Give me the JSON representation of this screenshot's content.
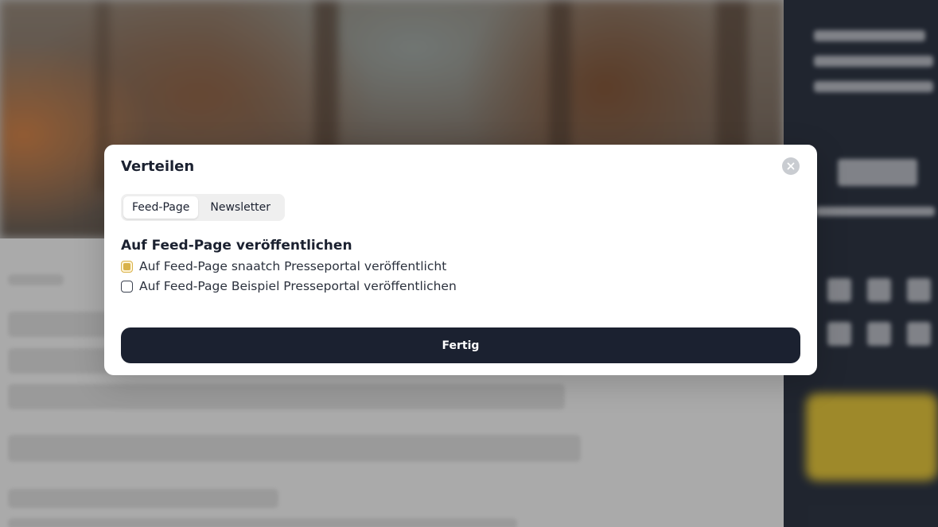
{
  "dialog": {
    "title": "Verteilen",
    "close_icon": "close-icon",
    "tabs": [
      {
        "label": "Feed-Page",
        "active": true
      },
      {
        "label": "Newsletter",
        "active": false
      }
    ],
    "section_title": "Auf Feed-Page veröffentlichen",
    "options": [
      {
        "label": "Auf Feed-Page snaatch Presseportal veröffentlicht",
        "checked": true
      },
      {
        "label": "Auf Feed-Page Beispiel Presseportal veröffentlichen",
        "checked": false
      }
    ],
    "done_label": "Fertig"
  },
  "colors": {
    "primary_button": "#1b2130",
    "checkbox_accent": "#d9b24a",
    "sidebar": "#1d2535"
  }
}
